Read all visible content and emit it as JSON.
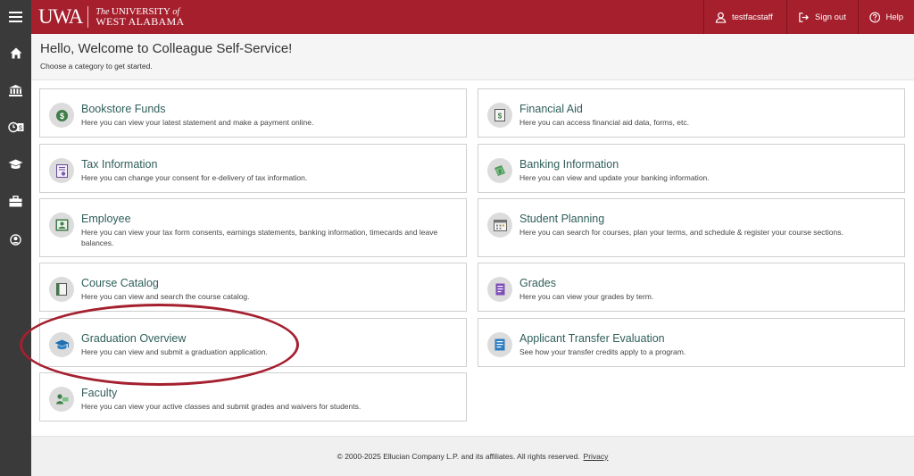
{
  "header": {
    "logo_mark": "UWA",
    "logo_line1_prefix": "The",
    "logo_line1": "UNIVERSITY",
    "logo_line1_suffix": "of",
    "logo_line2": "WEST ALABAMA",
    "user_label": "testfacstaff",
    "signout_label": "Sign out",
    "help_label": "Help"
  },
  "welcome": {
    "title": "Hello, Welcome to Colleague Self-Service!",
    "subtitle": "Choose a category to get started."
  },
  "cards": [
    {
      "title": "Bookstore Funds",
      "desc": "Here you can view your latest statement and make a payment online.",
      "icon": "dollar-icon"
    },
    {
      "title": "Financial Aid",
      "desc": "Here you can access financial aid data, forms, etc.",
      "icon": "financial-aid-icon"
    },
    {
      "title": "Tax Information",
      "desc": "Here you can change your consent for e-delivery of tax information.",
      "icon": "tax-document-icon"
    },
    {
      "title": "Banking Information",
      "desc": "Here you can view and update your banking information.",
      "icon": "money-icon"
    },
    {
      "title": "Employee",
      "desc": "Here you can view your tax form consents, earnings statements, banking information, timecards and leave balances.",
      "icon": "employee-badge-icon"
    },
    {
      "title": "Student Planning",
      "desc": "Here you can search for courses, plan your terms, and schedule & register your course sections.",
      "icon": "calendar-icon"
    },
    {
      "title": "Course Catalog",
      "desc": "Here you can view and search the course catalog.",
      "icon": "book-icon"
    },
    {
      "title": "Grades",
      "desc": "Here you can view your grades by term.",
      "icon": "grades-icon"
    },
    {
      "title": "Graduation Overview",
      "desc": "Here you can view and submit a graduation application.",
      "icon": "graduation-cap-icon"
    },
    {
      "title": "Applicant Transfer Evaluation",
      "desc": "See how your transfer credits apply to a program.",
      "icon": "transfer-document-icon"
    },
    {
      "title": "Faculty",
      "desc": "Here you can view your active classes and submit grades and waivers for students.",
      "icon": "faculty-icon"
    }
  ],
  "footer": {
    "copyright": "© 2000-2025 Ellucian Company L.P. and its affiliates. All rights reserved.",
    "privacy_label": "Privacy"
  },
  "colors": {
    "brand": "#a51f2d",
    "nav": "#3a3a3a",
    "card_title": "#2f5f5a",
    "annotation": "#a5202f"
  }
}
